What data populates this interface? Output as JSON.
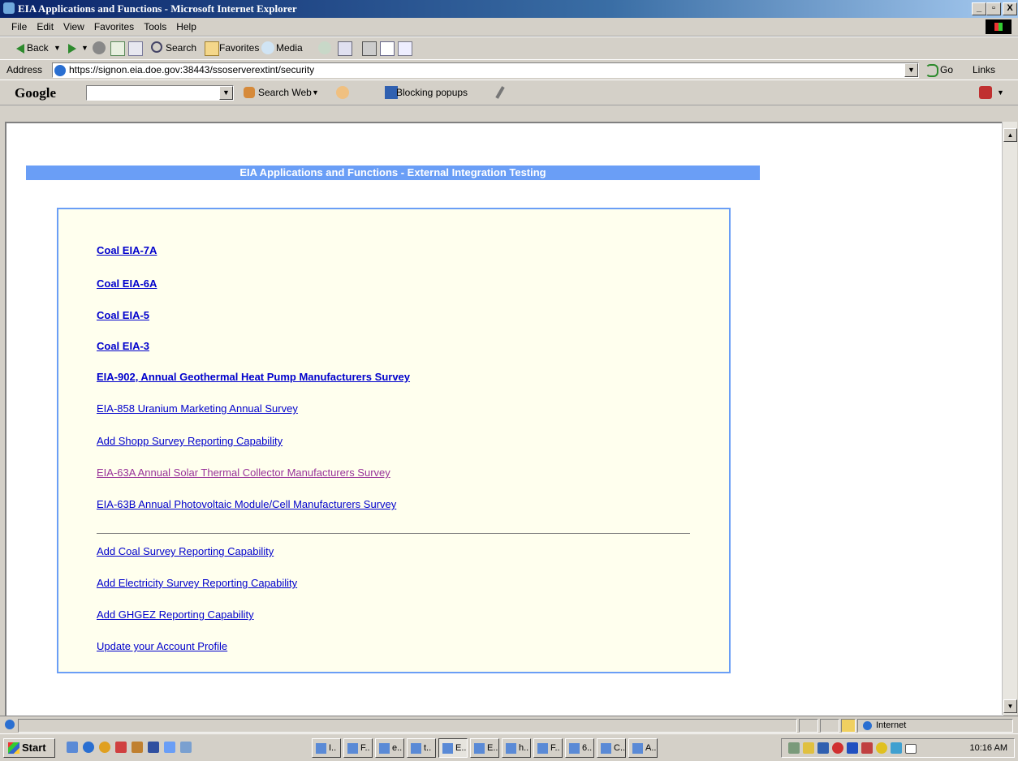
{
  "window": {
    "title": "EIA Applications and Functions - Microsoft Internet Explorer",
    "controls": [
      "_",
      "▫",
      "X"
    ]
  },
  "menu": [
    "File",
    "Edit",
    "View",
    "Favorites",
    "Tools",
    "Help"
  ],
  "toolbar": {
    "back": "Back",
    "search": "Search",
    "favorites": "Favorites",
    "media": "Media"
  },
  "address": {
    "label": "Address",
    "url": "https://signon.eia.doe.gov:38443/ssoserverextint/security",
    "go": "Go",
    "links": "Links"
  },
  "google_toolbar": {
    "logo": "Google",
    "search_web": "Search Web",
    "blocking": "Blocking popups"
  },
  "page": {
    "banner": "EIA Applications and Functions - External Integration Testing",
    "links": [
      {
        "label": "Coal EIA-7A",
        "bold": true,
        "visited": false
      },
      {
        "label": "Coal EIA-6A",
        "bold": true,
        "visited": false
      },
      {
        "label": "Coal EIA-5",
        "bold": true,
        "visited": false
      },
      {
        "label": "Coal EIA-3",
        "bold": true,
        "visited": false
      },
      {
        "label": "EIA-902, Annual Geothermal Heat Pump Manufacturers Survey",
        "bold": true,
        "visited": false
      },
      {
        "label": "EIA-858 Uranium Marketing Annual Survey",
        "bold": false,
        "visited": false
      },
      {
        "label": "Add Shopp Survey Reporting Capability",
        "bold": false,
        "visited": false
      },
      {
        "label": "EIA-63A Annual Solar Thermal Collector Manufacturers Survey",
        "bold": false,
        "visited": true
      },
      {
        "label": "EIA-63B Annual Photovoltaic Module/Cell Manufacturers Survey",
        "bold": false,
        "visited": false
      }
    ],
    "account_links": [
      {
        "label": "Add Coal Survey Reporting Capability"
      },
      {
        "label": "Add Electricity Survey Reporting Capability"
      },
      {
        "label": "Add GHGEZ Reporting Capability"
      },
      {
        "label": "Update your Account Profile"
      }
    ]
  },
  "status": {
    "zone": "Internet"
  },
  "taskbar": {
    "start": "Start",
    "tasks": [
      "I..",
      "F..",
      "e..",
      "t..",
      "E..",
      "E..",
      "h..",
      "F..",
      "6..",
      "C..",
      "A.."
    ],
    "active_task": 4,
    "clock": "10:16 AM"
  }
}
